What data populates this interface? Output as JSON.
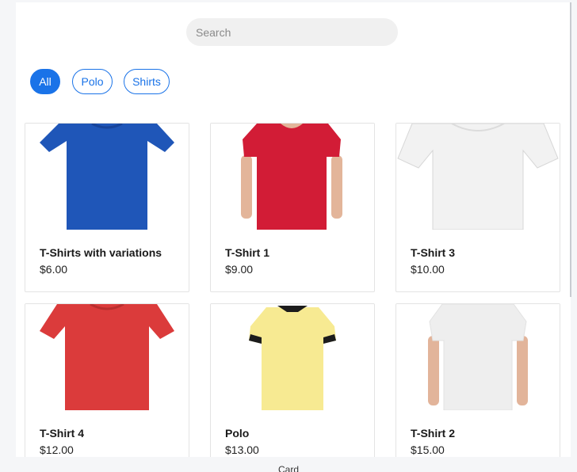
{
  "search": {
    "placeholder": "Search",
    "value": ""
  },
  "filters": [
    {
      "label": "All",
      "active": true
    },
    {
      "label": "Polo",
      "active": false
    },
    {
      "label": "Shirts",
      "active": false
    }
  ],
  "products": [
    {
      "name": "T-Shirts with variations",
      "price": "$6.00",
      "image": "blue-tshirt-image",
      "color": "#1f56b8"
    },
    {
      "name": "T-Shirt 1",
      "price": "$9.00",
      "image": "red-tshirt-model-image",
      "color": "#d21c36"
    },
    {
      "name": "T-Shirt 3",
      "price": "$10.00",
      "image": "white-tshirt-image",
      "color": "#f2f2f2"
    },
    {
      "name": "T-Shirt 4",
      "price": "$12.00",
      "image": "red-tshirt-image",
      "color": "#db3b3b"
    },
    {
      "name": "Polo",
      "price": "$13.00",
      "image": "yellow-polo-image",
      "color": "#f7ea92"
    },
    {
      "name": "T-Shirt 2",
      "price": "$15.00",
      "image": "white-tshirt-model-image",
      "color": "#eeeeee"
    }
  ],
  "footer": {
    "label": "Card"
  },
  "colors": {
    "accent": "#1a73e8",
    "page_bg": "#f5f6f8",
    "search_bg": "#f0f0f0"
  }
}
